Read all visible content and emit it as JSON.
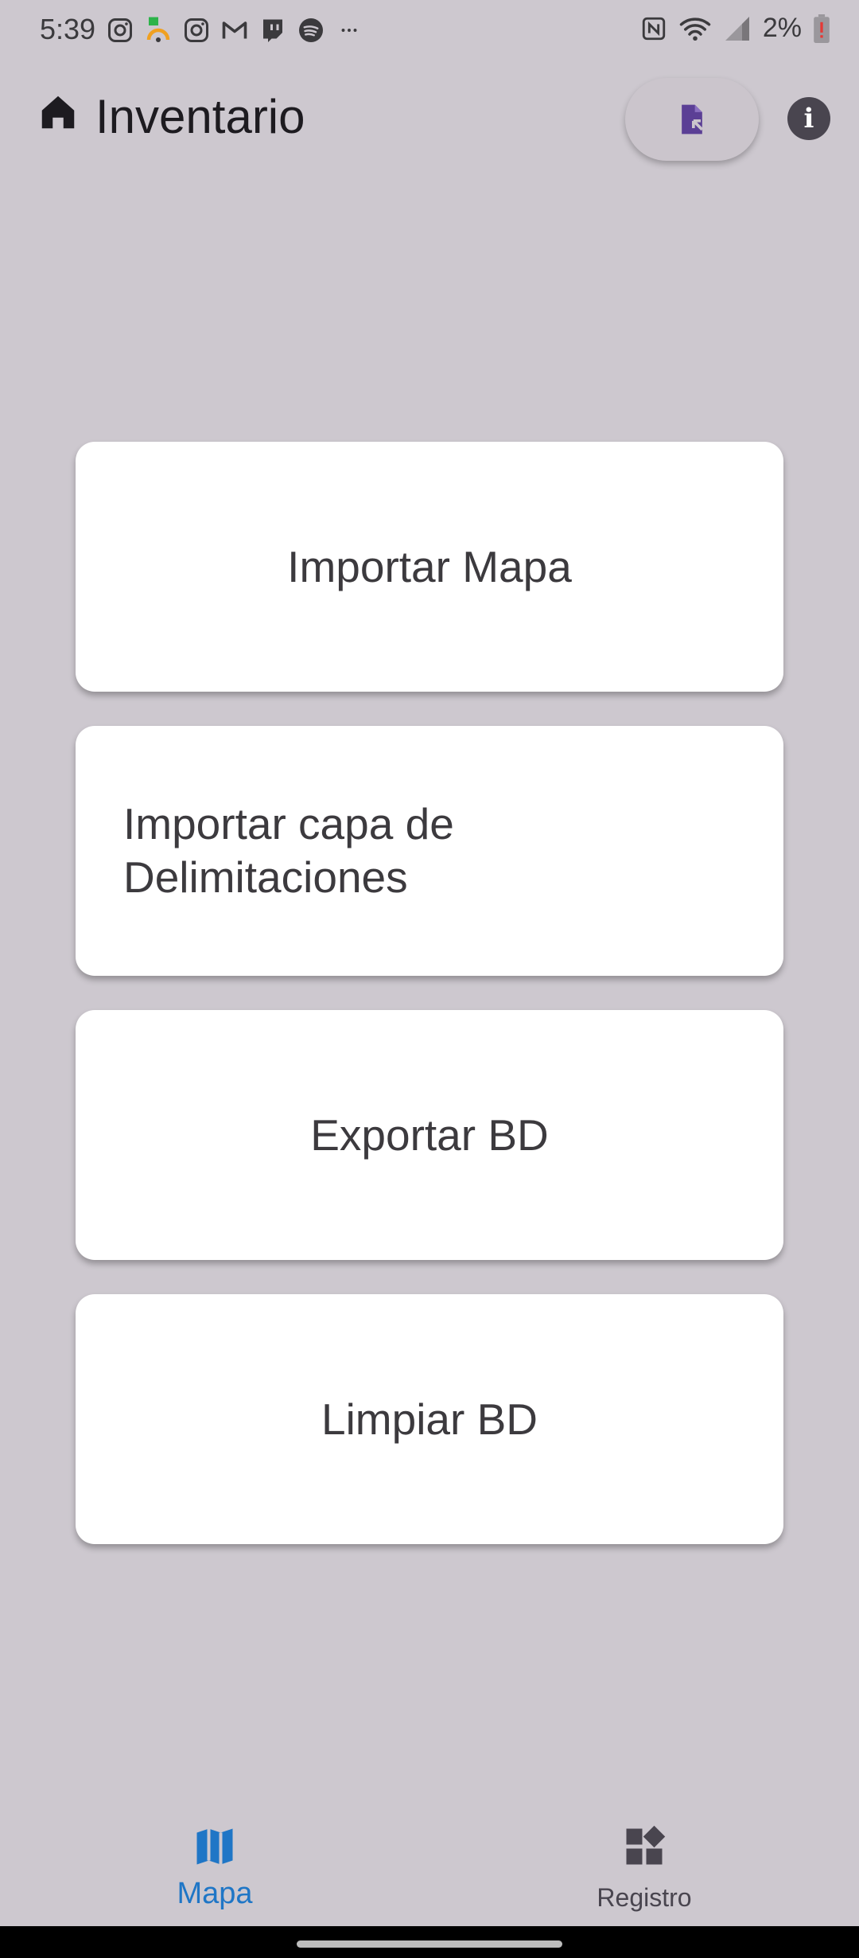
{
  "status_bar": {
    "time": "5:39",
    "notification_icons": [
      "instagram-icon",
      "td-app-icon",
      "instagram-icon",
      "gmail-icon",
      "twitch-icon",
      "spotify-icon",
      "more-dots-icon"
    ],
    "right_icons": [
      "nfc-icon",
      "wifi-icon",
      "signal-icon",
      "battery-low-icon"
    ],
    "battery_percent": "2%"
  },
  "app_bar": {
    "title": "Inventario",
    "leading_icon": "home-icon",
    "actions": [
      "file-import-icon",
      "info-icon"
    ]
  },
  "cards": [
    {
      "label": "Importar Mapa"
    },
    {
      "label": "Importar capa de Delimitaciones"
    },
    {
      "label": "Exportar BD"
    },
    {
      "label": "Limpiar BD"
    }
  ],
  "bottom_nav": {
    "items": [
      {
        "label": "Mapa",
        "icon": "map-icon",
        "selected": true
      },
      {
        "label": "Registro",
        "icon": "widgets-icon",
        "selected": false
      }
    ]
  },
  "colors": {
    "background": "#cdc8cf",
    "accent": "#1f76c6",
    "file_icon": "#5b3f95",
    "card": "#ffffff"
  }
}
